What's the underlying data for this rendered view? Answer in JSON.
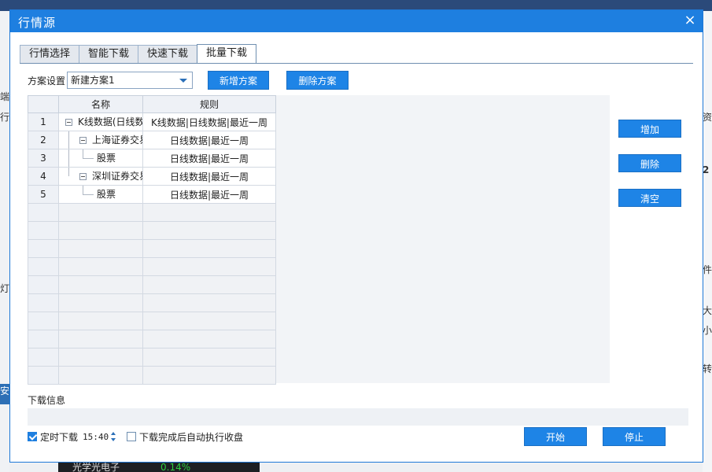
{
  "background": {
    "left_frags": [
      "端",
      "行",
      "灯",
      "安"
    ],
    "right_frags": [
      "资",
      "2",
      "件",
      "大",
      "小",
      "转"
    ],
    "ticker": {
      "name": "光学光电子",
      "pct": "0.14%"
    }
  },
  "dialog": {
    "title": "行情源",
    "close_icon": "×"
  },
  "tabs": [
    {
      "label": "行情选择",
      "active": false
    },
    {
      "label": "智能下载",
      "active": false
    },
    {
      "label": "快速下载",
      "active": false
    },
    {
      "label": "批量下载",
      "active": true
    }
  ],
  "scheme": {
    "label": "方案设置",
    "selected": "新建方案1",
    "add_button": "新增方案",
    "delete_button": "删除方案"
  },
  "grid": {
    "columns": [
      "名称",
      "规则"
    ],
    "rows": [
      {
        "num": "1",
        "name": "K线数据(日线数",
        "rule": "K线数据|日线数据|最近一周",
        "level": 0
      },
      {
        "num": "2",
        "name": "上海证券交易",
        "rule": "日线数据|最近一周",
        "level": 1
      },
      {
        "num": "3",
        "name": "股票",
        "rule": "日线数据|最近一周",
        "level": 2
      },
      {
        "num": "4",
        "name": "深圳证券交易",
        "rule": "日线数据|最近一周",
        "level": 1
      },
      {
        "num": "5",
        "name": "股票",
        "rule": "日线数据|最近一周",
        "level": 2
      }
    ]
  },
  "side_buttons": {
    "add": "增加",
    "delete": "删除",
    "clear": "清空"
  },
  "download_info": {
    "label": "下载信息"
  },
  "bottom": {
    "timer_checked": true,
    "timer_label": "定时下载",
    "time_value": "15:40",
    "auto_close_checked": false,
    "auto_close_label": "下载完成后自动执行收盘",
    "start_button": "开始",
    "stop_button": "停止"
  }
}
